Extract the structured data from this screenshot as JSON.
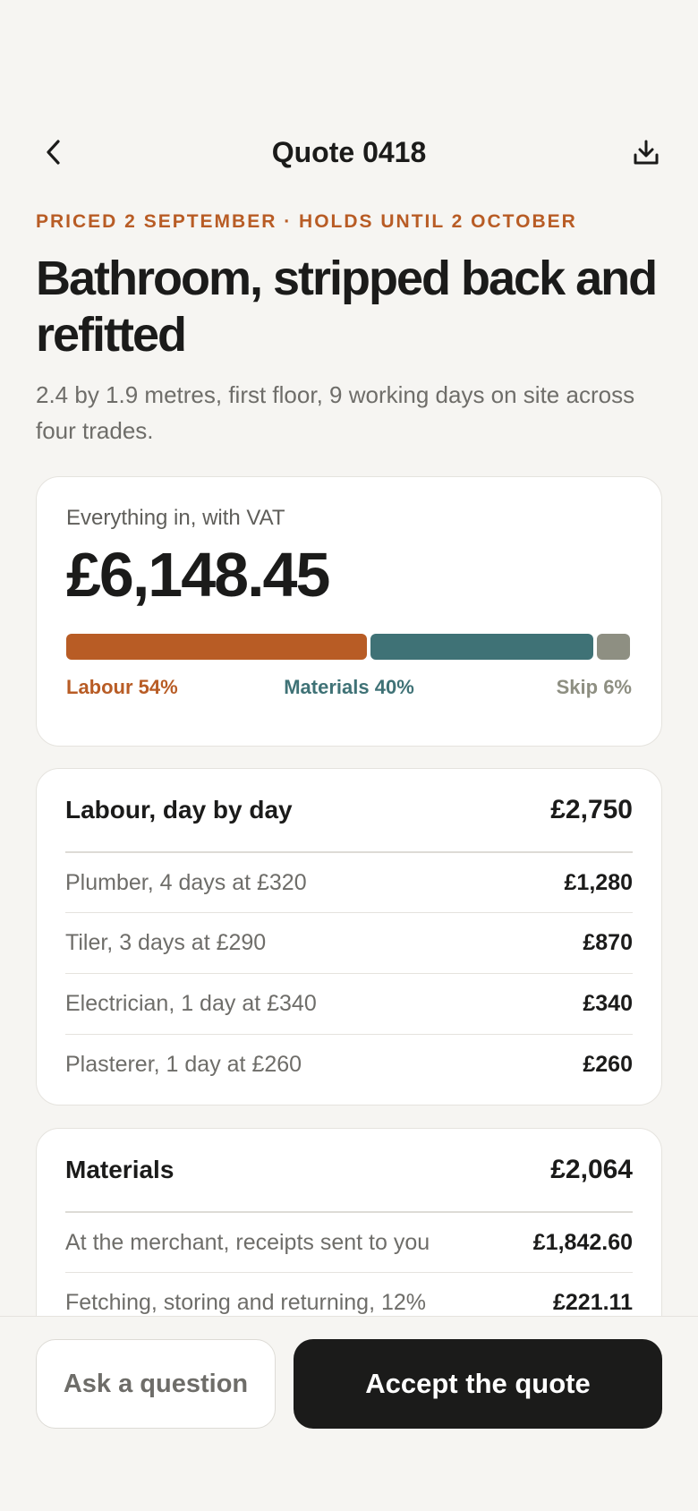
{
  "header": {
    "back_icon": "chevron-left-icon",
    "title": "Quote 0418",
    "download_icon": "download-icon"
  },
  "quote": {
    "eyebrow": "PRICED 2 SEPTEMBER · HOLDS UNTIL 2 OCTOBER",
    "headline": "Bathroom, stripped back and refitted",
    "subline": "2.4 by 1.9 metres, first floor, 9 working days on site across four trades."
  },
  "total": {
    "label": "Everything in, with VAT",
    "amount": "£6,148.45",
    "split": [
      {
        "label": "Labour 54%",
        "share": 0.54,
        "color": "#b85c25"
      },
      {
        "label": "Materials 40%",
        "share": 0.4,
        "color": "#3f7276"
      },
      {
        "label": "Skip 6%",
        "share": 0.06,
        "color": "#8e8f82"
      }
    ]
  },
  "labour": {
    "title": "Labour, day by day",
    "total": "£2,750",
    "items": [
      {
        "label": "Plumber, 4 days at £320",
        "amount": "£1,280"
      },
      {
        "label": "Tiler, 3 days at £290",
        "amount": "£870"
      },
      {
        "label": "Electrician, 1 day at £340",
        "amount": "£340"
      },
      {
        "label": "Plasterer, 1 day at £260",
        "amount": "£260"
      }
    ]
  },
  "materials": {
    "title": "Materials",
    "total": "£2,064",
    "items": [
      {
        "label": "At the merchant, receipts sent to you",
        "amount": "£1,842.60"
      },
      {
        "label": "Fetching, storing and returning, 12%",
        "amount": "£221.11"
      }
    ]
  },
  "actions": {
    "ask": "Ask a question",
    "accept": "Accept the quote"
  }
}
